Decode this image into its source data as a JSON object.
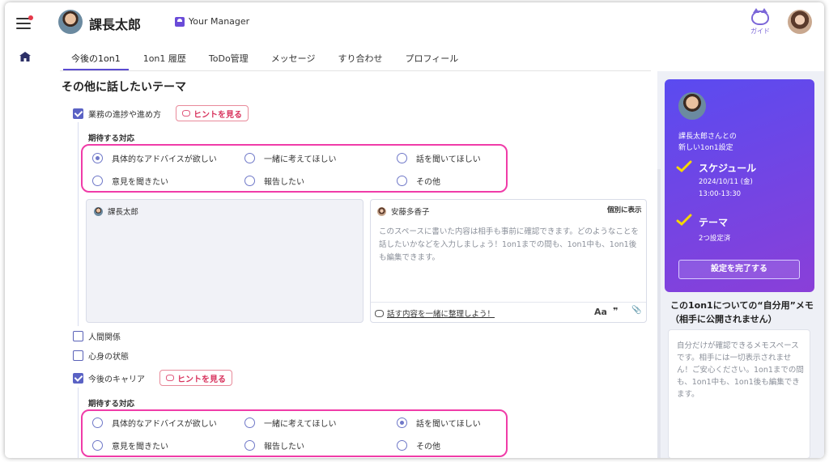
{
  "header": {
    "user_name": "課長太郎",
    "manager_badge": "Your Manager",
    "guide_label": "ガイド"
  },
  "tabs": [
    {
      "label": "今後の1on1",
      "active": true
    },
    {
      "label": "1on1 履歴",
      "active": false
    },
    {
      "label": "ToDo管理",
      "active": false
    },
    {
      "label": "メッセージ",
      "active": false
    },
    {
      "label": "すり合わせ",
      "active": false
    },
    {
      "label": "プロフィール",
      "active": false
    }
  ],
  "section_title": "その他に話したいテーマ",
  "themes": [
    {
      "label": "業務の進捗や進め方",
      "checked": true
    },
    {
      "label": "人間関係",
      "checked": false
    },
    {
      "label": "心身の状態",
      "checked": false
    },
    {
      "label": "今後のキャリア",
      "checked": true
    }
  ],
  "hint_button_label": "ヒントを見る",
  "expected_label": "期待する対応",
  "response_options": [
    "具体的なアドバイスが欲しい",
    "一緒に考えてほしい",
    "話を聞いてほしい",
    "意見を聞きたい",
    "報告したい",
    "その他"
  ],
  "group1_selected": "具体的なアドバイスが欲しい",
  "group2_selected": "話を聞いてほしい",
  "memo": {
    "left_author": "課長太郎",
    "right_author": "安藤多香子",
    "individual_view": "個別に表示",
    "placeholder": "このスペースに書いた内容は相手も事前に確認できます。どのようなことを話したいかなどを入力しましょう！1on1までの間も、1on1中も、1on1後も編集できます。",
    "organize_link": "話す内容を一緒に整理しよう！",
    "format_aa": "Aa",
    "format_quote": "❞",
    "format_attach": "📎"
  },
  "promo": {
    "line1": "課長太郎さんとの",
    "line2": "新しい1on1設定",
    "schedule_title": "スケジュール",
    "schedule_date": "2024/10/11 (金)",
    "schedule_time": "13:00-13:30",
    "theme_title": "テーマ",
    "theme_status": "2つ設定済",
    "complete_button": "設定を完了する"
  },
  "self_memo": {
    "title": "この1on1についての“自分用”メモ（相手に公開されません）",
    "placeholder": "自分だけが確認できるメモスペースです。相手には一切表示されません！ご安心ください。1on1までの間も、1on1中も、1on1後も編集できます。"
  },
  "colors": {
    "accent": "#5b4bd1",
    "highlight_border": "#f03ca8",
    "hint_pink": "#d8345e",
    "promo_start": "#5a4bf0",
    "promo_end": "#8a3fd8",
    "check_yellow": "#f5d800"
  },
  "icons": {
    "menu": "hamburger-icon",
    "home": "home-icon",
    "guide": "cat-guide-icon",
    "hint": "cat-icon",
    "check": "check-mark-icon"
  }
}
